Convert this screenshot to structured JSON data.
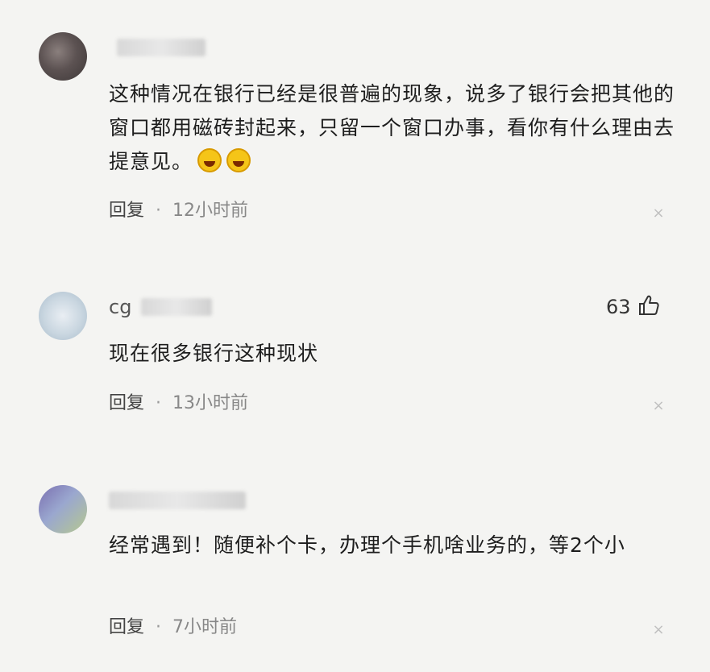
{
  "comments": [
    {
      "name_fragment": "",
      "text": "这种情况在银行已经是很普遍的现象，说多了银行会把其他的窗口都用磁砖封起来，只留一个窗口办事，看你有什么理由去提意见。",
      "emoji": [
        "grin-emoji",
        "laugh-emoji"
      ],
      "reply_label": "回复",
      "separator": "·",
      "time": "12小时前",
      "close": "×"
    },
    {
      "name_fragment": "cg",
      "text": "现在很多银行这种现状",
      "likes": "63",
      "reply_label": "回复",
      "separator": "·",
      "time": "13小时前",
      "close": "×"
    },
    {
      "name_fragment": "",
      "text": "经常遇到！随便补个卡，办理个手机啥业务的，等2个小",
      "reply_label": "回复",
      "separator": "·",
      "time": "7小时前",
      "close": "×"
    }
  ],
  "icons": {
    "like": "thumbs-up-icon",
    "close": "close-icon"
  },
  "colors": {
    "background": "#f4f4f2",
    "text": "#1e1e1e",
    "meta": "#888888"
  }
}
